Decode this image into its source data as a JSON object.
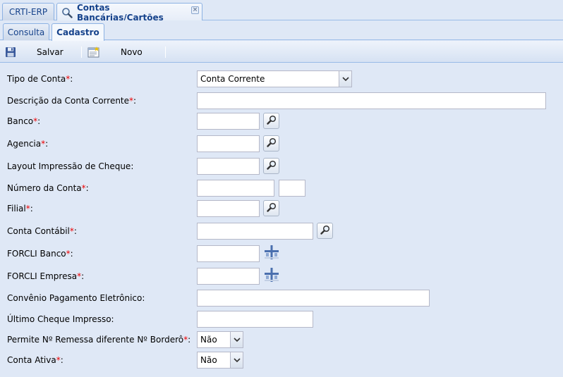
{
  "window_tabs": [
    {
      "label": "CRTI-ERP"
    },
    {
      "label": "Contas Bancárias/Cartões"
    }
  ],
  "sub_tabs": [
    {
      "label": "Consulta"
    },
    {
      "label": "Cadastro"
    }
  ],
  "toolbar": {
    "save_label": "Salvar",
    "new_label": "Novo"
  },
  "form": {
    "tipo_conta": {
      "label": "Tipo de Conta",
      "value": "Conta Corrente"
    },
    "descricao": {
      "label": "Descrição da Conta Corrente",
      "value": ""
    },
    "banco": {
      "label": "Banco",
      "value": ""
    },
    "agencia": {
      "label": "Agencia",
      "value": ""
    },
    "layout_cheque": {
      "label": "Layout Impressão de Cheque",
      "value": ""
    },
    "numero_conta": {
      "label": "Número da Conta",
      "value": "",
      "digit": ""
    },
    "filial": {
      "label": "Filial",
      "value": ""
    },
    "conta_contabil": {
      "label": "Conta Contábil",
      "value": ""
    },
    "forcli_banco": {
      "label": "FORCLI Banco",
      "value": ""
    },
    "forcli_empresa": {
      "label": "FORCLI Empresa",
      "value": ""
    },
    "convenio": {
      "label": "Convênio Pagamento Eletrônico",
      "value": ""
    },
    "ultimo_cheque": {
      "label": "Último Cheque Impresso",
      "value": ""
    },
    "permite_remessa": {
      "label": "Permite Nº Remessa diferente Nº Borderô",
      "value": "Não"
    },
    "conta_ativa": {
      "label": "Conta Ativa",
      "value": "Não"
    }
  },
  "required_marker": "*",
  "colon": ":"
}
